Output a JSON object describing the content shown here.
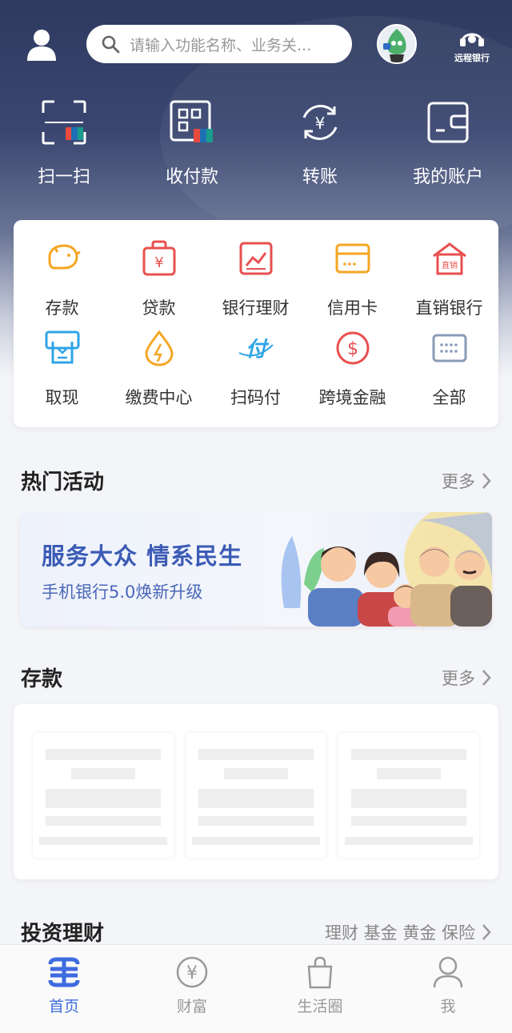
{
  "topbar": {
    "search_placeholder": "请输入功能名称、业务关...",
    "brand_name": "远程银行"
  },
  "quick_actions": [
    {
      "label": "扫一扫",
      "icon": "scan-icon"
    },
    {
      "label": "收付款",
      "icon": "qr-pay-icon"
    },
    {
      "label": "转账",
      "icon": "transfer-icon"
    },
    {
      "label": "我的账户",
      "icon": "wallet-icon"
    }
  ],
  "services": [
    {
      "label": "存款",
      "icon": "piggy-bank-icon",
      "color": "#f5a623"
    },
    {
      "label": "贷款",
      "icon": "loan-bag-icon",
      "color": "#e8504f"
    },
    {
      "label": "银行理财",
      "icon": "chart-icon",
      "color": "#e8504f"
    },
    {
      "label": "信用卡",
      "icon": "credit-card-icon",
      "color": "#f5a623"
    },
    {
      "label": "直销银行",
      "icon": "direct-bank-icon",
      "color": "#e8504f"
    },
    {
      "label": "取现",
      "icon": "cash-withdraw-icon",
      "color": "#2fa4e7"
    },
    {
      "label": "缴费中心",
      "icon": "payment-center-icon",
      "color": "#f5a623"
    },
    {
      "label": "扫码付",
      "icon": "scan-pay-icon",
      "color": "#2fa4e7"
    },
    {
      "label": "跨境金融",
      "icon": "cross-border-icon",
      "color": "#e8504f"
    },
    {
      "label": "全部",
      "icon": "all-grid-icon",
      "color": "#8a9bb8"
    }
  ],
  "direct_bank_badge": "直销",
  "scan_pay_glyph": "付",
  "hot_section": {
    "title": "热门活动",
    "more": "更多"
  },
  "banner": {
    "headline": "服务大众  情系民生",
    "subline": "手机银行5.0焕新升级"
  },
  "deposit_section": {
    "title": "存款",
    "more": "更多"
  },
  "invest_section": {
    "title": "投资理财",
    "links": "理财 基金 黄金 保险"
  },
  "tabs": [
    {
      "label": "首页",
      "active": true,
      "icon": "home-logo-icon"
    },
    {
      "label": "财富",
      "active": false,
      "icon": "wealth-icon"
    },
    {
      "label": "生活圈",
      "active": false,
      "icon": "shopping-bag-icon"
    },
    {
      "label": "我",
      "active": false,
      "icon": "profile-icon"
    }
  ],
  "colors": {
    "accent": "#3d6be0",
    "header_dark": "#2e3a5f",
    "banner_text": "#3b5bb5"
  }
}
